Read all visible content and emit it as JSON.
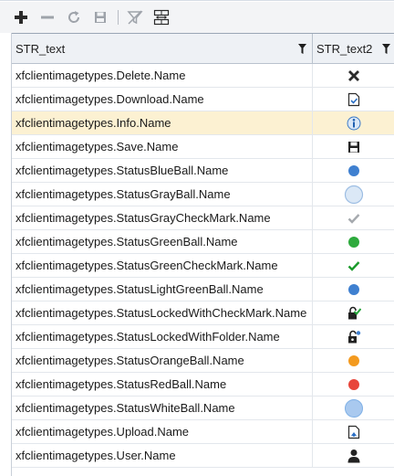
{
  "toolbar": {
    "buttons": [
      {
        "icon": "add-icon",
        "enabled": true
      },
      {
        "icon": "remove-icon",
        "enabled": false
      },
      {
        "icon": "refresh-icon",
        "enabled": false
      },
      {
        "icon": "save-icon",
        "enabled": false
      },
      {
        "icon": "clear-filter-icon",
        "enabled": false
      },
      {
        "icon": "fit-columns-icon",
        "enabled": true
      }
    ]
  },
  "grid": {
    "columns": [
      {
        "label": "STR_text"
      },
      {
        "label": "STR_text2"
      }
    ],
    "rows": [
      {
        "text": "xfclientimagetypes.Delete.Name",
        "icon": "delete-icon"
      },
      {
        "text": "xfclientimagetypes.Download.Name",
        "icon": "download-icon"
      },
      {
        "text": "xfclientimagetypes.Info.Name",
        "icon": "info-icon",
        "selected": true
      },
      {
        "text": "xfclientimagetypes.Save.Name",
        "icon": "save-icon"
      },
      {
        "text": "xfclientimagetypes.StatusBlueBall.Name",
        "icon": "blue-ball-icon"
      },
      {
        "text": "xfclientimagetypes.StatusGrayBall.Name",
        "icon": "gray-ball-icon"
      },
      {
        "text": "xfclientimagetypes.StatusGrayCheckMark.Name",
        "icon": "gray-check-icon"
      },
      {
        "text": "xfclientimagetypes.StatusGreenBall.Name",
        "icon": "green-ball-icon"
      },
      {
        "text": "xfclientimagetypes.StatusGreenCheckMark.Name",
        "icon": "green-check-icon"
      },
      {
        "text": "xfclientimagetypes.StatusLightGreenBall.Name",
        "icon": "light-green-ball-icon"
      },
      {
        "text": "xfclientimagetypes.StatusLockedWithCheckMark.Name",
        "icon": "locked-check-icon"
      },
      {
        "text": "xfclientimagetypes.StatusLockedWithFolder.Name",
        "icon": "locked-folder-icon"
      },
      {
        "text": "xfclientimagetypes.StatusOrangeBall.Name",
        "icon": "orange-ball-icon"
      },
      {
        "text": "xfclientimagetypes.StatusRedBall.Name",
        "icon": "red-ball-icon"
      },
      {
        "text": "xfclientimagetypes.StatusWhiteBall.Name",
        "icon": "white-ball-icon"
      },
      {
        "text": "xfclientimagetypes.Upload.Name",
        "icon": "upload-icon"
      },
      {
        "text": "xfclientimagetypes.User.Name",
        "icon": "user-icon"
      }
    ]
  },
  "colors": {
    "selected_row": "#fcf1d2",
    "header_bg": "#eef1f5",
    "blue_ball": "#3f80d0",
    "green_ball": "#2eaa3d",
    "orange_ball": "#f39a1f",
    "red_ball": "#e8453a"
  }
}
